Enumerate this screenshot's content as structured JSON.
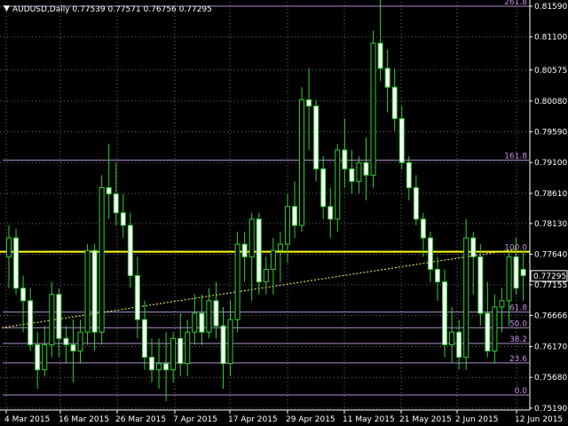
{
  "header": {
    "dropdown_glyph": "▼",
    "title": "AUDUSD,Daily  0.77539 0.77571 0.76756 0.77295"
  },
  "colors": {
    "background": "#000000",
    "grid": "#6e6e6e",
    "candle": "#2fd12f",
    "bull_body": "#000000",
    "bear_body": "#ffffff",
    "fib_line": "#b58bd6",
    "fib_label": "#c88ee4",
    "main_line": "#ffff00",
    "trend_line": "#ffff66",
    "axis_text": "#ffffff",
    "current_box_bg": "#000000",
    "current_box_border": "#ffffff"
  },
  "chart_data": {
    "type": "candlestick",
    "y_range": [
      0.7516,
      0.8166
    ],
    "price_ticks": [
      "0.81590",
      "0.81100",
      "0.80575",
      "0.80080",
      "0.79590",
      "0.79100",
      "0.78610",
      "0.78130",
      "0.77640",
      "0.77155",
      "0.76666",
      "0.76170",
      "0.75680",
      "0.75190"
    ],
    "current_price": "0.77295",
    "date_ticks": [
      "4 Mar 2015",
      "16 Mar 2015",
      "26 Mar 2015",
      "7 Apr 2015",
      "17 Apr 2015",
      "29 Apr 2015",
      "11 May 2015",
      "21 May 2015",
      "2 Jun 2015",
      "12 Jun 2015"
    ],
    "fibonacci": [
      {
        "label": "261.8",
        "price": 0.8159
      },
      {
        "label": "161.8",
        "price": 0.7914
      },
      {
        "label": "100.0",
        "price": 0.7768
      },
      {
        "label": "61.8",
        "price": 0.7672
      },
      {
        "label": "50.0",
        "price": 0.7647
      },
      {
        "label": "38.2",
        "price": 0.7622
      },
      {
        "label": "23.6",
        "price": 0.7591
      },
      {
        "label": "0.0",
        "price": 0.754
      }
    ],
    "main_line_price": 0.7768,
    "trend_line": {
      "from": [
        0,
        0.7647
      ],
      "to": [
        71,
        0.7772
      ]
    },
    "candles": [
      {
        "o": 0.776,
        "h": 0.781,
        "l": 0.771,
        "c": 0.779
      },
      {
        "o": 0.779,
        "h": 0.7805,
        "l": 0.77,
        "c": 0.771
      },
      {
        "o": 0.771,
        "h": 0.773,
        "l": 0.764,
        "c": 0.769
      },
      {
        "o": 0.769,
        "h": 0.771,
        "l": 0.761,
        "c": 0.762
      },
      {
        "o": 0.762,
        "h": 0.764,
        "l": 0.755,
        "c": 0.758
      },
      {
        "o": 0.758,
        "h": 0.765,
        "l": 0.757,
        "c": 0.762
      },
      {
        "o": 0.762,
        "h": 0.772,
        "l": 0.76,
        "c": 0.77
      },
      {
        "o": 0.77,
        "h": 0.771,
        "l": 0.76,
        "c": 0.763
      },
      {
        "o": 0.763,
        "h": 0.765,
        "l": 0.759,
        "c": 0.762
      },
      {
        "o": 0.762,
        "h": 0.766,
        "l": 0.756,
        "c": 0.761
      },
      {
        "o": 0.761,
        "h": 0.766,
        "l": 0.759,
        "c": 0.764
      },
      {
        "o": 0.764,
        "h": 0.778,
        "l": 0.762,
        "c": 0.777
      },
      {
        "o": 0.777,
        "h": 0.778,
        "l": 0.761,
        "c": 0.764
      },
      {
        "o": 0.764,
        "h": 0.789,
        "l": 0.762,
        "c": 0.787
      },
      {
        "o": 0.787,
        "h": 0.794,
        "l": 0.782,
        "c": 0.786
      },
      {
        "o": 0.786,
        "h": 0.791,
        "l": 0.781,
        "c": 0.783
      },
      {
        "o": 0.783,
        "h": 0.786,
        "l": 0.779,
        "c": 0.781
      },
      {
        "o": 0.781,
        "h": 0.783,
        "l": 0.771,
        "c": 0.773
      },
      {
        "o": 0.773,
        "h": 0.776,
        "l": 0.763,
        "c": 0.766
      },
      {
        "o": 0.766,
        "h": 0.769,
        "l": 0.758,
        "c": 0.76
      },
      {
        "o": 0.76,
        "h": 0.763,
        "l": 0.756,
        "c": 0.758
      },
      {
        "o": 0.758,
        "h": 0.763,
        "l": 0.755,
        "c": 0.759
      },
      {
        "o": 0.759,
        "h": 0.764,
        "l": 0.753,
        "c": 0.758
      },
      {
        "o": 0.758,
        "h": 0.764,
        "l": 0.756,
        "c": 0.763
      },
      {
        "o": 0.763,
        "h": 0.767,
        "l": 0.757,
        "c": 0.759
      },
      {
        "o": 0.759,
        "h": 0.766,
        "l": 0.757,
        "c": 0.764
      },
      {
        "o": 0.764,
        "h": 0.77,
        "l": 0.762,
        "c": 0.767
      },
      {
        "o": 0.767,
        "h": 0.77,
        "l": 0.762,
        "c": 0.764
      },
      {
        "o": 0.764,
        "h": 0.771,
        "l": 0.763,
        "c": 0.769
      },
      {
        "o": 0.769,
        "h": 0.772,
        "l": 0.763,
        "c": 0.765
      },
      {
        "o": 0.765,
        "h": 0.768,
        "l": 0.755,
        "c": 0.759
      },
      {
        "o": 0.759,
        "h": 0.769,
        "l": 0.757,
        "c": 0.766
      },
      {
        "o": 0.766,
        "h": 0.78,
        "l": 0.764,
        "c": 0.778
      },
      {
        "o": 0.778,
        "h": 0.78,
        "l": 0.772,
        "c": 0.776
      },
      {
        "o": 0.776,
        "h": 0.783,
        "l": 0.769,
        "c": 0.782
      },
      {
        "o": 0.782,
        "h": 0.783,
        "l": 0.77,
        "c": 0.772
      },
      {
        "o": 0.772,
        "h": 0.776,
        "l": 0.77,
        "c": 0.774
      },
      {
        "o": 0.774,
        "h": 0.779,
        "l": 0.77,
        "c": 0.777
      },
      {
        "o": 0.777,
        "h": 0.78,
        "l": 0.772,
        "c": 0.778
      },
      {
        "o": 0.778,
        "h": 0.786,
        "l": 0.775,
        "c": 0.784
      },
      {
        "o": 0.784,
        "h": 0.788,
        "l": 0.779,
        "c": 0.781
      },
      {
        "o": 0.781,
        "h": 0.803,
        "l": 0.78,
        "c": 0.801
      },
      {
        "o": 0.801,
        "h": 0.806,
        "l": 0.793,
        "c": 0.8
      },
      {
        "o": 0.8,
        "h": 0.801,
        "l": 0.788,
        "c": 0.79
      },
      {
        "o": 0.79,
        "h": 0.792,
        "l": 0.782,
        "c": 0.784
      },
      {
        "o": 0.784,
        "h": 0.787,
        "l": 0.779,
        "c": 0.782
      },
      {
        "o": 0.782,
        "h": 0.794,
        "l": 0.78,
        "c": 0.793
      },
      {
        "o": 0.793,
        "h": 0.798,
        "l": 0.787,
        "c": 0.79
      },
      {
        "o": 0.79,
        "h": 0.793,
        "l": 0.786,
        "c": 0.788
      },
      {
        "o": 0.788,
        "h": 0.792,
        "l": 0.786,
        "c": 0.791
      },
      {
        "o": 0.791,
        "h": 0.795,
        "l": 0.785,
        "c": 0.789
      },
      {
        "o": 0.789,
        "h": 0.812,
        "l": 0.787,
        "c": 0.81
      },
      {
        "o": 0.81,
        "h": 0.817,
        "l": 0.804,
        "c": 0.806
      },
      {
        "o": 0.806,
        "h": 0.809,
        "l": 0.799,
        "c": 0.803
      },
      {
        "o": 0.803,
        "h": 0.806,
        "l": 0.796,
        "c": 0.798
      },
      {
        "o": 0.798,
        "h": 0.8,
        "l": 0.79,
        "c": 0.791
      },
      {
        "o": 0.791,
        "h": 0.792,
        "l": 0.785,
        "c": 0.787
      },
      {
        "o": 0.787,
        "h": 0.789,
        "l": 0.781,
        "c": 0.782
      },
      {
        "o": 0.782,
        "h": 0.783,
        "l": 0.776,
        "c": 0.779
      },
      {
        "o": 0.779,
        "h": 0.78,
        "l": 0.772,
        "c": 0.774
      },
      {
        "o": 0.774,
        "h": 0.776,
        "l": 0.769,
        "c": 0.772
      },
      {
        "o": 0.772,
        "h": 0.774,
        "l": 0.76,
        "c": 0.762
      },
      {
        "o": 0.762,
        "h": 0.768,
        "l": 0.759,
        "c": 0.764
      },
      {
        "o": 0.764,
        "h": 0.766,
        "l": 0.758,
        "c": 0.76
      },
      {
        "o": 0.76,
        "h": 0.782,
        "l": 0.758,
        "c": 0.779
      },
      {
        "o": 0.779,
        "h": 0.78,
        "l": 0.77,
        "c": 0.776
      },
      {
        "o": 0.776,
        "h": 0.778,
        "l": 0.765,
        "c": 0.767
      },
      {
        "o": 0.767,
        "h": 0.772,
        "l": 0.76,
        "c": 0.761
      },
      {
        "o": 0.761,
        "h": 0.77,
        "l": 0.759,
        "c": 0.768
      },
      {
        "o": 0.768,
        "h": 0.771,
        "l": 0.764,
        "c": 0.769
      },
      {
        "o": 0.769,
        "h": 0.777,
        "l": 0.765,
        "c": 0.776
      },
      {
        "o": 0.776,
        "h": 0.779,
        "l": 0.77,
        "c": 0.771
      },
      {
        "o": 0.774,
        "h": 0.777,
        "l": 0.769,
        "c": 0.773
      }
    ]
  }
}
